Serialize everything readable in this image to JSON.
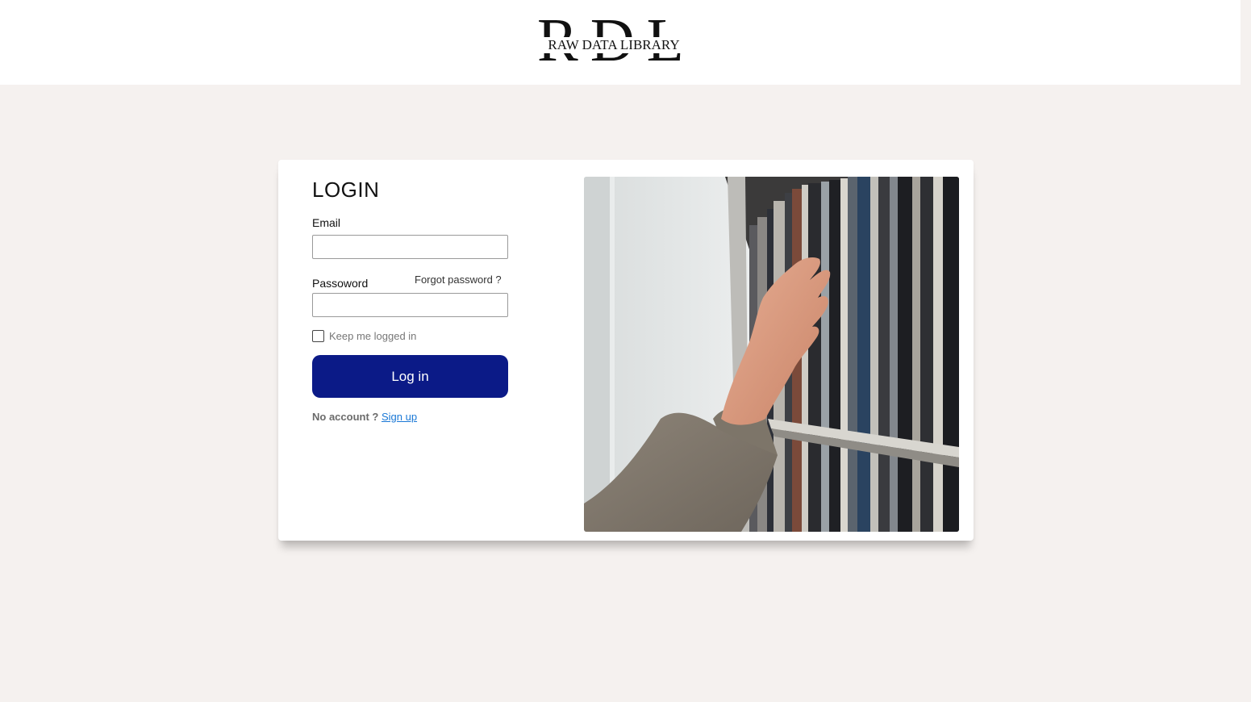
{
  "header": {
    "logo_initials": "RDL",
    "logo_text": "RAW DATA LIBRARY"
  },
  "login": {
    "title": "LOGIN",
    "email_label": "Email",
    "email_value": "",
    "password_label": "Passoword",
    "password_value": "",
    "forgot_password": "Forgot password ?",
    "keep_logged_in": "Keep me logged in",
    "keep_logged_in_checked": false,
    "login_button": "Log in",
    "no_account": "No account ?",
    "signup_link": "Sign up"
  },
  "photo": {
    "description_icon": "library-photo"
  },
  "colors": {
    "page_background": "#f5f1ef",
    "header_background": "#ffffff",
    "button_background": "#0b1a87",
    "link": "#1a78d6"
  }
}
